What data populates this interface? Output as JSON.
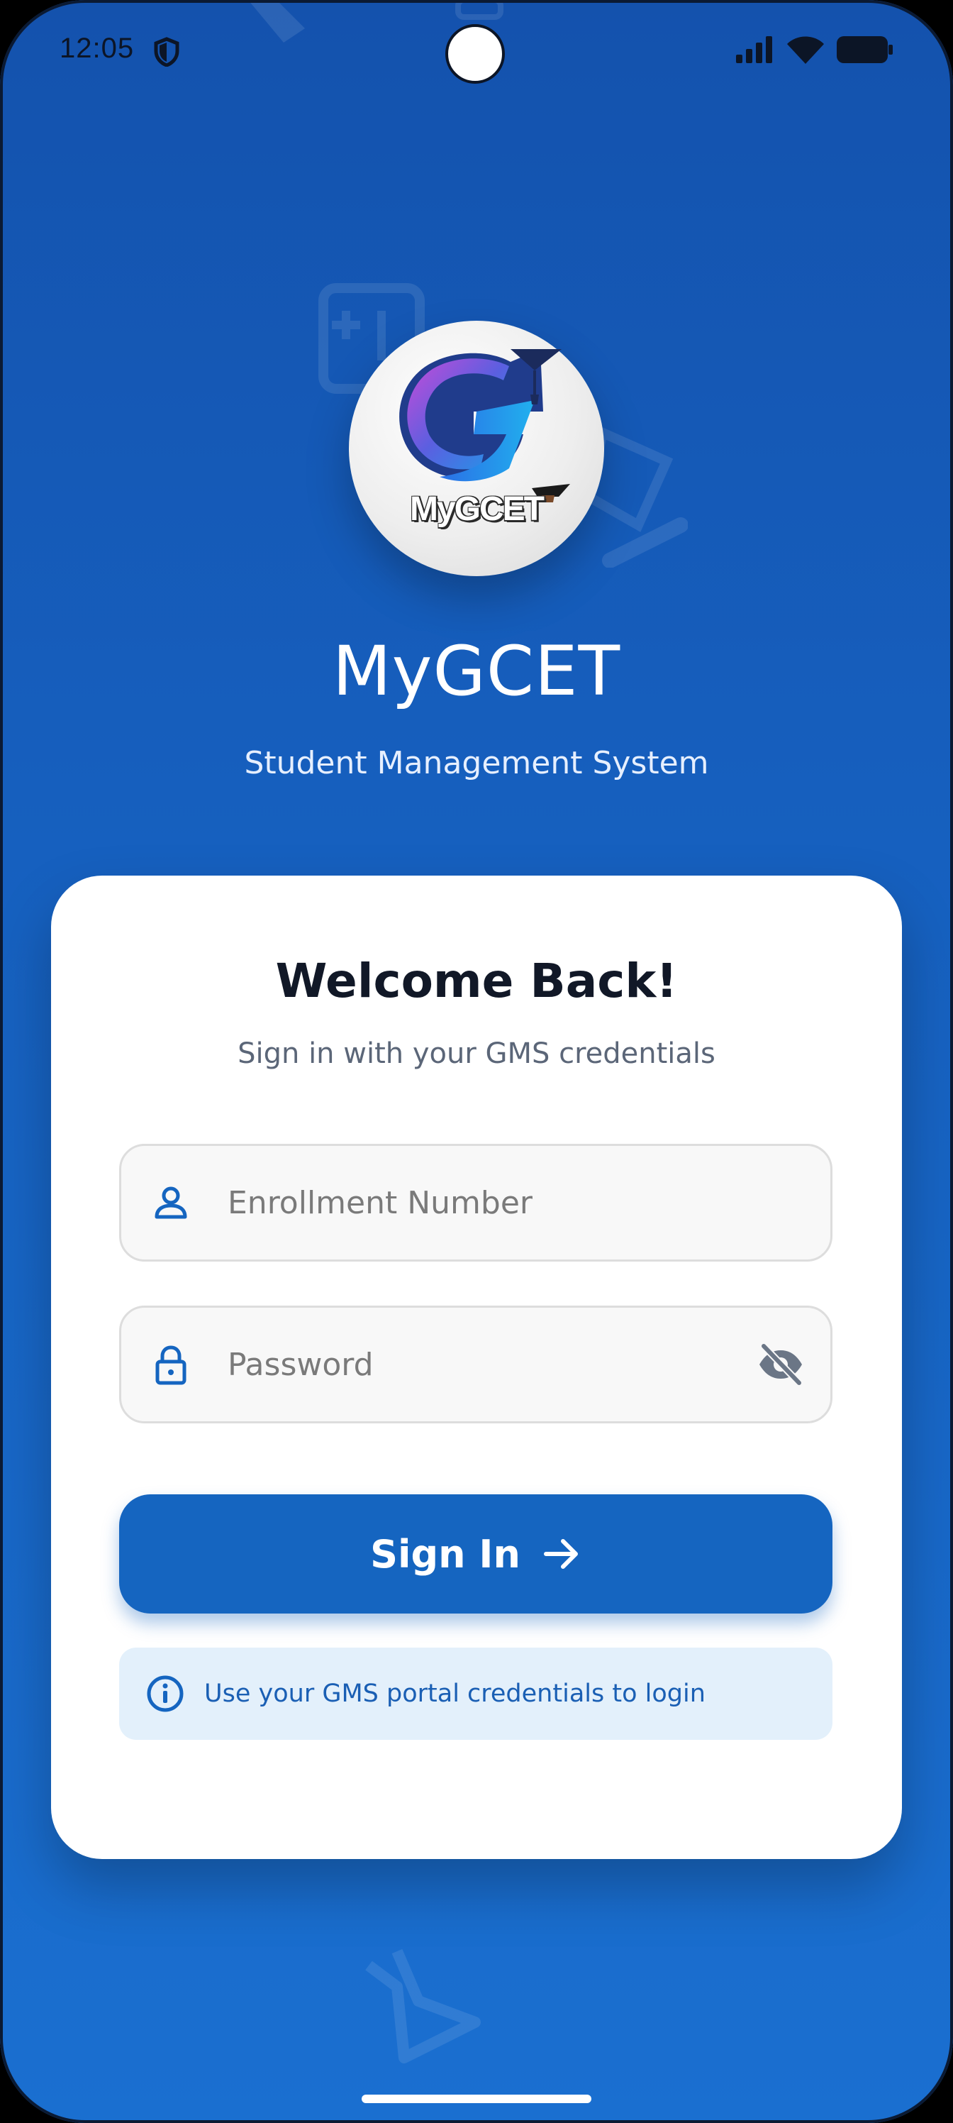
{
  "status_bar": {
    "time": "12:05",
    "icons": [
      "shield-icon",
      "signal-icon",
      "wifi-icon",
      "battery-icon"
    ]
  },
  "logo": {
    "text": "MyGCET",
    "icon": "graduation-g-logo"
  },
  "header": {
    "title": "MyGCET",
    "subtitle": "Student Management System"
  },
  "login_card": {
    "title": "Welcome Back!",
    "subtitle": "Sign in with your GMS credentials",
    "enrollment_field": {
      "placeholder": "Enrollment Number",
      "value": "",
      "icon": "person-icon"
    },
    "password_field": {
      "placeholder": "Password",
      "value": "",
      "icon": "lock-icon",
      "toggle_icon": "eye-off-icon"
    },
    "sign_in_button": {
      "label": "Sign In",
      "icon": "arrow-right-icon"
    },
    "info": {
      "text": "Use your GMS portal credentials to login",
      "icon": "info-icon"
    }
  },
  "colors": {
    "background_top": "#1452ad",
    "background_bottom": "#1a6fd0",
    "primary": "#1565c0",
    "card": "#ffffff",
    "info_bg": "#e3f0fb"
  }
}
